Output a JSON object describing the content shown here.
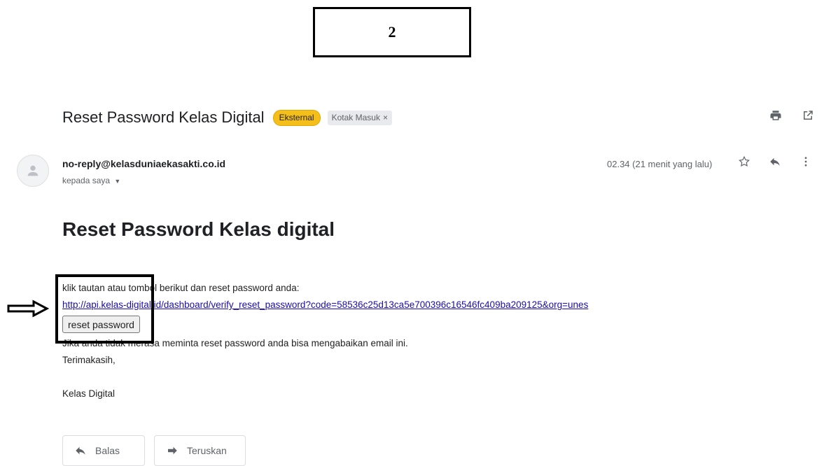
{
  "step_label": "2",
  "email": {
    "subject": "Reset Password Kelas Digital",
    "labels": {
      "external": "Eksternal",
      "inbox": "Kotak Masuk",
      "inbox_remove": "×"
    },
    "toolbar_icons": [
      "print-icon",
      "open-in-new-window-icon"
    ],
    "sender": "no-reply@kelasduniaekasakti.co.id",
    "recipient": "kepada saya",
    "time": "02.34 (21 menit yang lalu)",
    "message_icons": [
      "star-icon",
      "reply-icon",
      "more-vertical-icon"
    ]
  },
  "body": {
    "heading": "Reset Password Kelas digital",
    "intro": "klik tautan atau tombol berikut dan reset password anda:",
    "link": "http://api.kelas-digital.id/dashboard/verify_reset_password?code=58536c25d13ca5e700396c16546fc409ba209125&org=unes",
    "button": "reset password",
    "ignore_note": "Jika anda tidak merasa meminta reset password anda bisa mengabaikan email ini.",
    "thanks": "Terimakasih,",
    "signature": "Kelas Digital"
  },
  "actions": {
    "reply": "Balas",
    "forward": "Teruskan"
  },
  "colors": {
    "external_label": "#f5bf1b",
    "link": "#1a0dab"
  }
}
